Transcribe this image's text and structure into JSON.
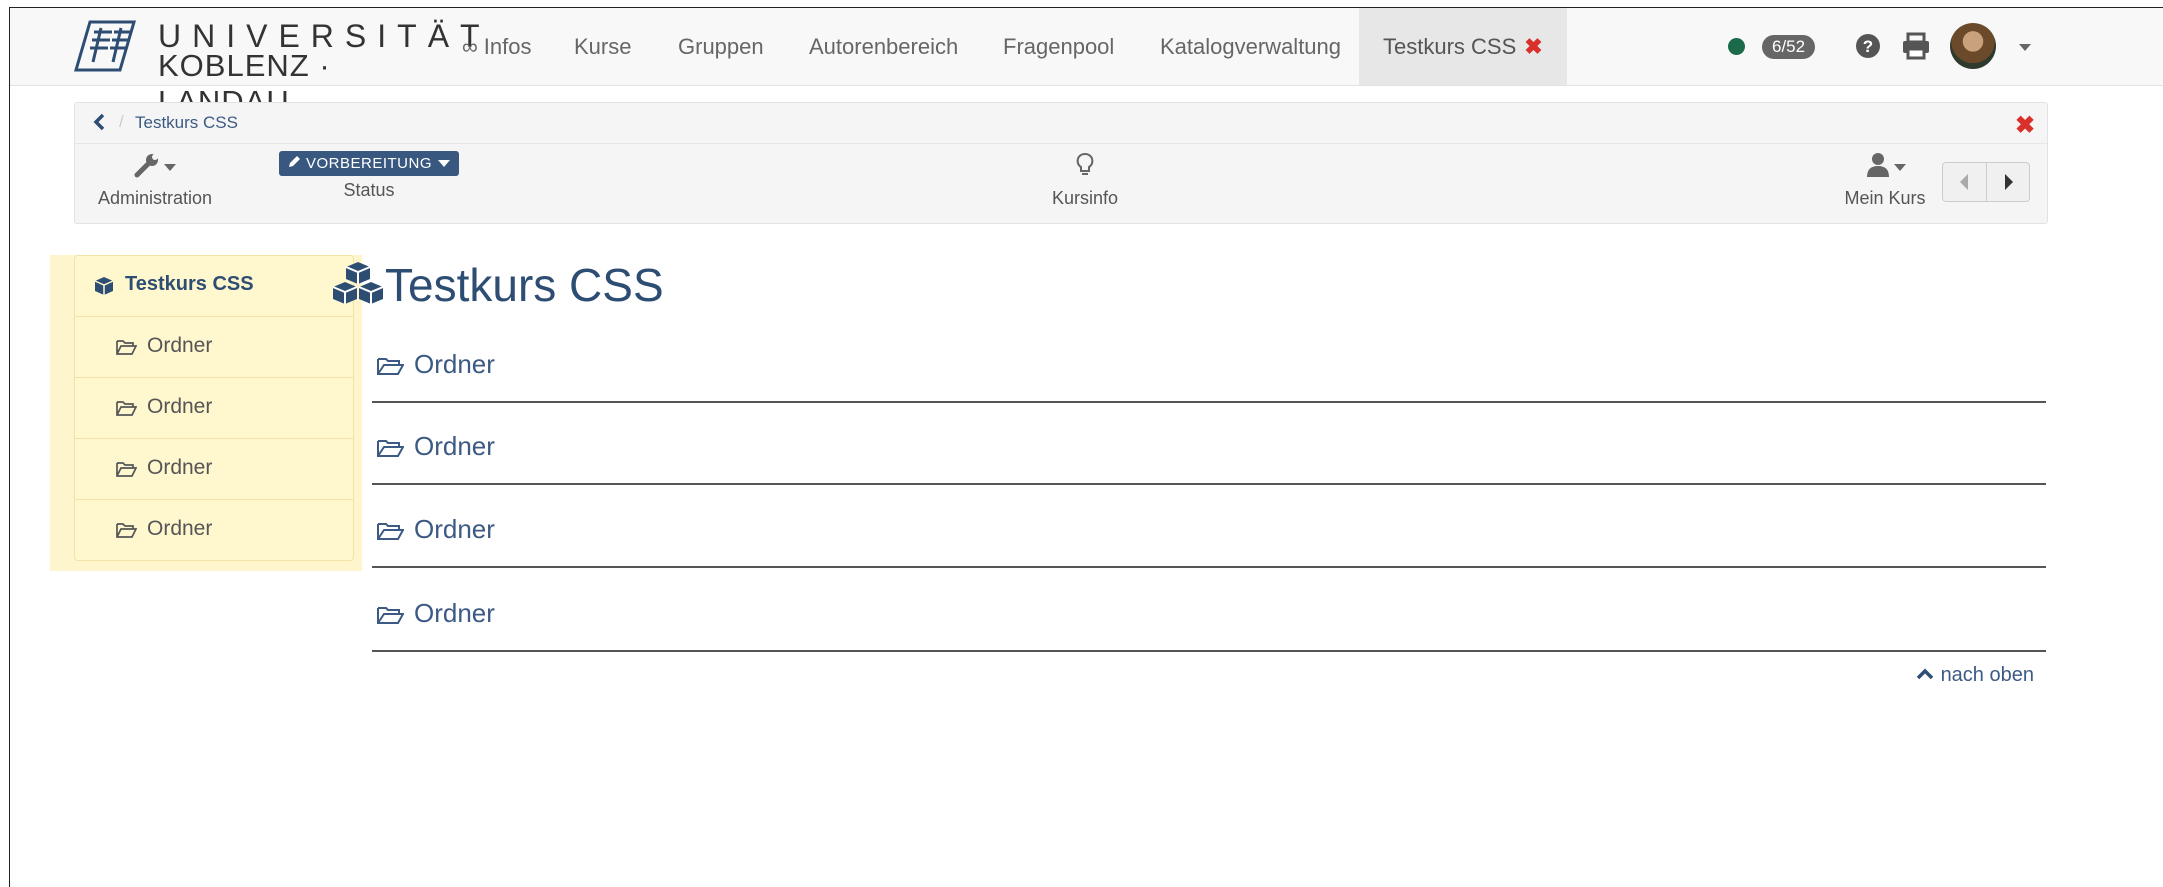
{
  "brand": {
    "line1": "UNIVERSITÄT",
    "line2": "KOBLENZ · LANDAU"
  },
  "nav": {
    "items": [
      {
        "label": "∞ Infos"
      },
      {
        "label": "Kurse"
      },
      {
        "label": "Gruppen"
      },
      {
        "label": "Autorenbereich"
      },
      {
        "label": "Fragenpool"
      },
      {
        "label": "Katalogverwaltung"
      }
    ],
    "active_tab": {
      "label": "Testkurs CSS",
      "close_glyph": "✖"
    },
    "badge": "6/52",
    "status_color": "#1b6b4b",
    "icons": [
      "help-icon",
      "print-icon"
    ]
  },
  "toolbar": {
    "breadcrumb": {
      "separator": "/",
      "current": "Testkurs CSS"
    },
    "close_glyph": "✖",
    "administration_label": "Administration",
    "status_button": "VORBEREITUNG",
    "status_label": "Status",
    "kursinfo_label": "Kursinfo",
    "mein_kurs_label": "Mein Kurs"
  },
  "menu": {
    "root": "Testkurs CSS",
    "items": [
      "Ordner",
      "Ordner",
      "Ordner",
      "Ordner"
    ]
  },
  "main": {
    "title": "Testkurs CSS",
    "sections": [
      "Ordner",
      "Ordner",
      "Ordner",
      "Ordner"
    ],
    "to_top": "nach oben"
  },
  "colors": {
    "accent": "#2e4d73",
    "link": "#3c5a84",
    "menu_bg": "#fff8cf",
    "close": "#d9302c"
  }
}
